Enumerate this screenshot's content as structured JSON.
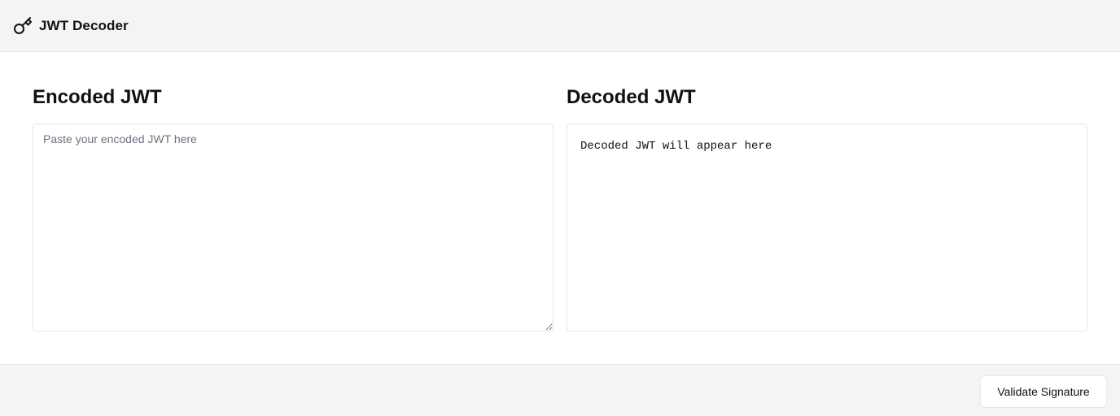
{
  "header": {
    "app_title": "JWT Decoder",
    "icon": "key-icon"
  },
  "encoded_panel": {
    "heading": "Encoded JWT",
    "input_value": "",
    "placeholder": "Paste your encoded JWT here"
  },
  "decoded_panel": {
    "heading": "Decoded JWT",
    "output_text": "Decoded JWT will appear here"
  },
  "footer": {
    "validate_label": "Validate Signature"
  },
  "colors": {
    "bar_background": "#f3f4f6",
    "border": "#e5e7eb",
    "placeholder": "#6b7280"
  }
}
